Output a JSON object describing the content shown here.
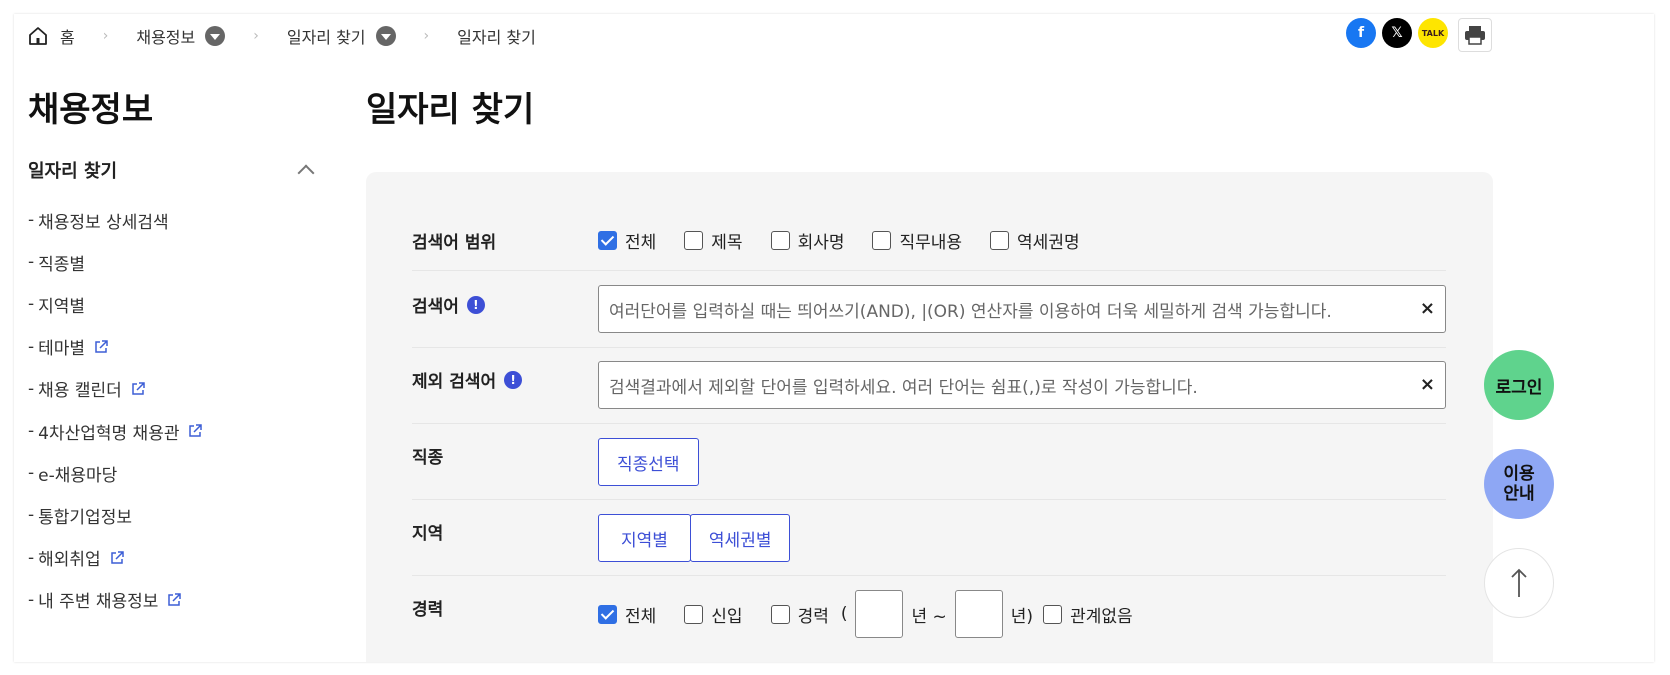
{
  "breadcrumb": {
    "home": "홈",
    "level1": "채용정보",
    "level2": "일자리 찾기",
    "current": "일자리 찾기"
  },
  "share": {
    "facebook": "f",
    "x": "𝕏",
    "kakao": "TALK"
  },
  "sidebar": {
    "title": "채용정보",
    "section": "일자리 찾기",
    "items": [
      {
        "label": "채용정보 상세검색",
        "external": false
      },
      {
        "label": "직종별",
        "external": false
      },
      {
        "label": "지역별",
        "external": false
      },
      {
        "label": "테마별",
        "external": true
      },
      {
        "label": "채용 캘린더",
        "external": true
      },
      {
        "label": "4차산업혁명 채용관",
        "external": true
      },
      {
        "label": "e-채용마당",
        "external": false
      },
      {
        "label": "통합기업정보",
        "external": false
      },
      {
        "label": "해외취업",
        "external": true
      },
      {
        "label": "내 주변 채용정보",
        "external": true
      }
    ]
  },
  "main": {
    "title": "일자리 찾기",
    "search_scope": {
      "label": "검색어 범위",
      "options": [
        {
          "label": "전체",
          "checked": true
        },
        {
          "label": "제목",
          "checked": false
        },
        {
          "label": "회사명",
          "checked": false
        },
        {
          "label": "직무내용",
          "checked": false
        },
        {
          "label": "역세권명",
          "checked": false
        }
      ]
    },
    "keyword": {
      "label": "검색어",
      "placeholder": "여러단어를 입력하실 때는 띄어쓰기(AND), |(OR) 연산자를 이용하여 더욱 세밀하게 검색 가능합니다.",
      "clear": "×"
    },
    "exclude": {
      "label": "제외 검색어",
      "placeholder": "검색결과에서 제외할 단어를 입력하세요. 여러 단어는 쉼표(,)로 작성이 가능합니다.",
      "clear": "×"
    },
    "job_type": {
      "label": "직종",
      "button": "직종선택"
    },
    "region": {
      "label": "지역",
      "buttons": [
        "지역별",
        "역세권별"
      ]
    },
    "career": {
      "label": "경력",
      "options": [
        {
          "label": "전체",
          "checked": true
        },
        {
          "label": "신입",
          "checked": false
        },
        {
          "label": "경력",
          "checked": false
        }
      ],
      "open_paren": "(",
      "year_from": "년 ~",
      "year_to": "년)",
      "no_matter": "관계없음"
    }
  },
  "floating": {
    "login": "로그인",
    "guide_line1": "이용",
    "guide_line2": "안내"
  }
}
